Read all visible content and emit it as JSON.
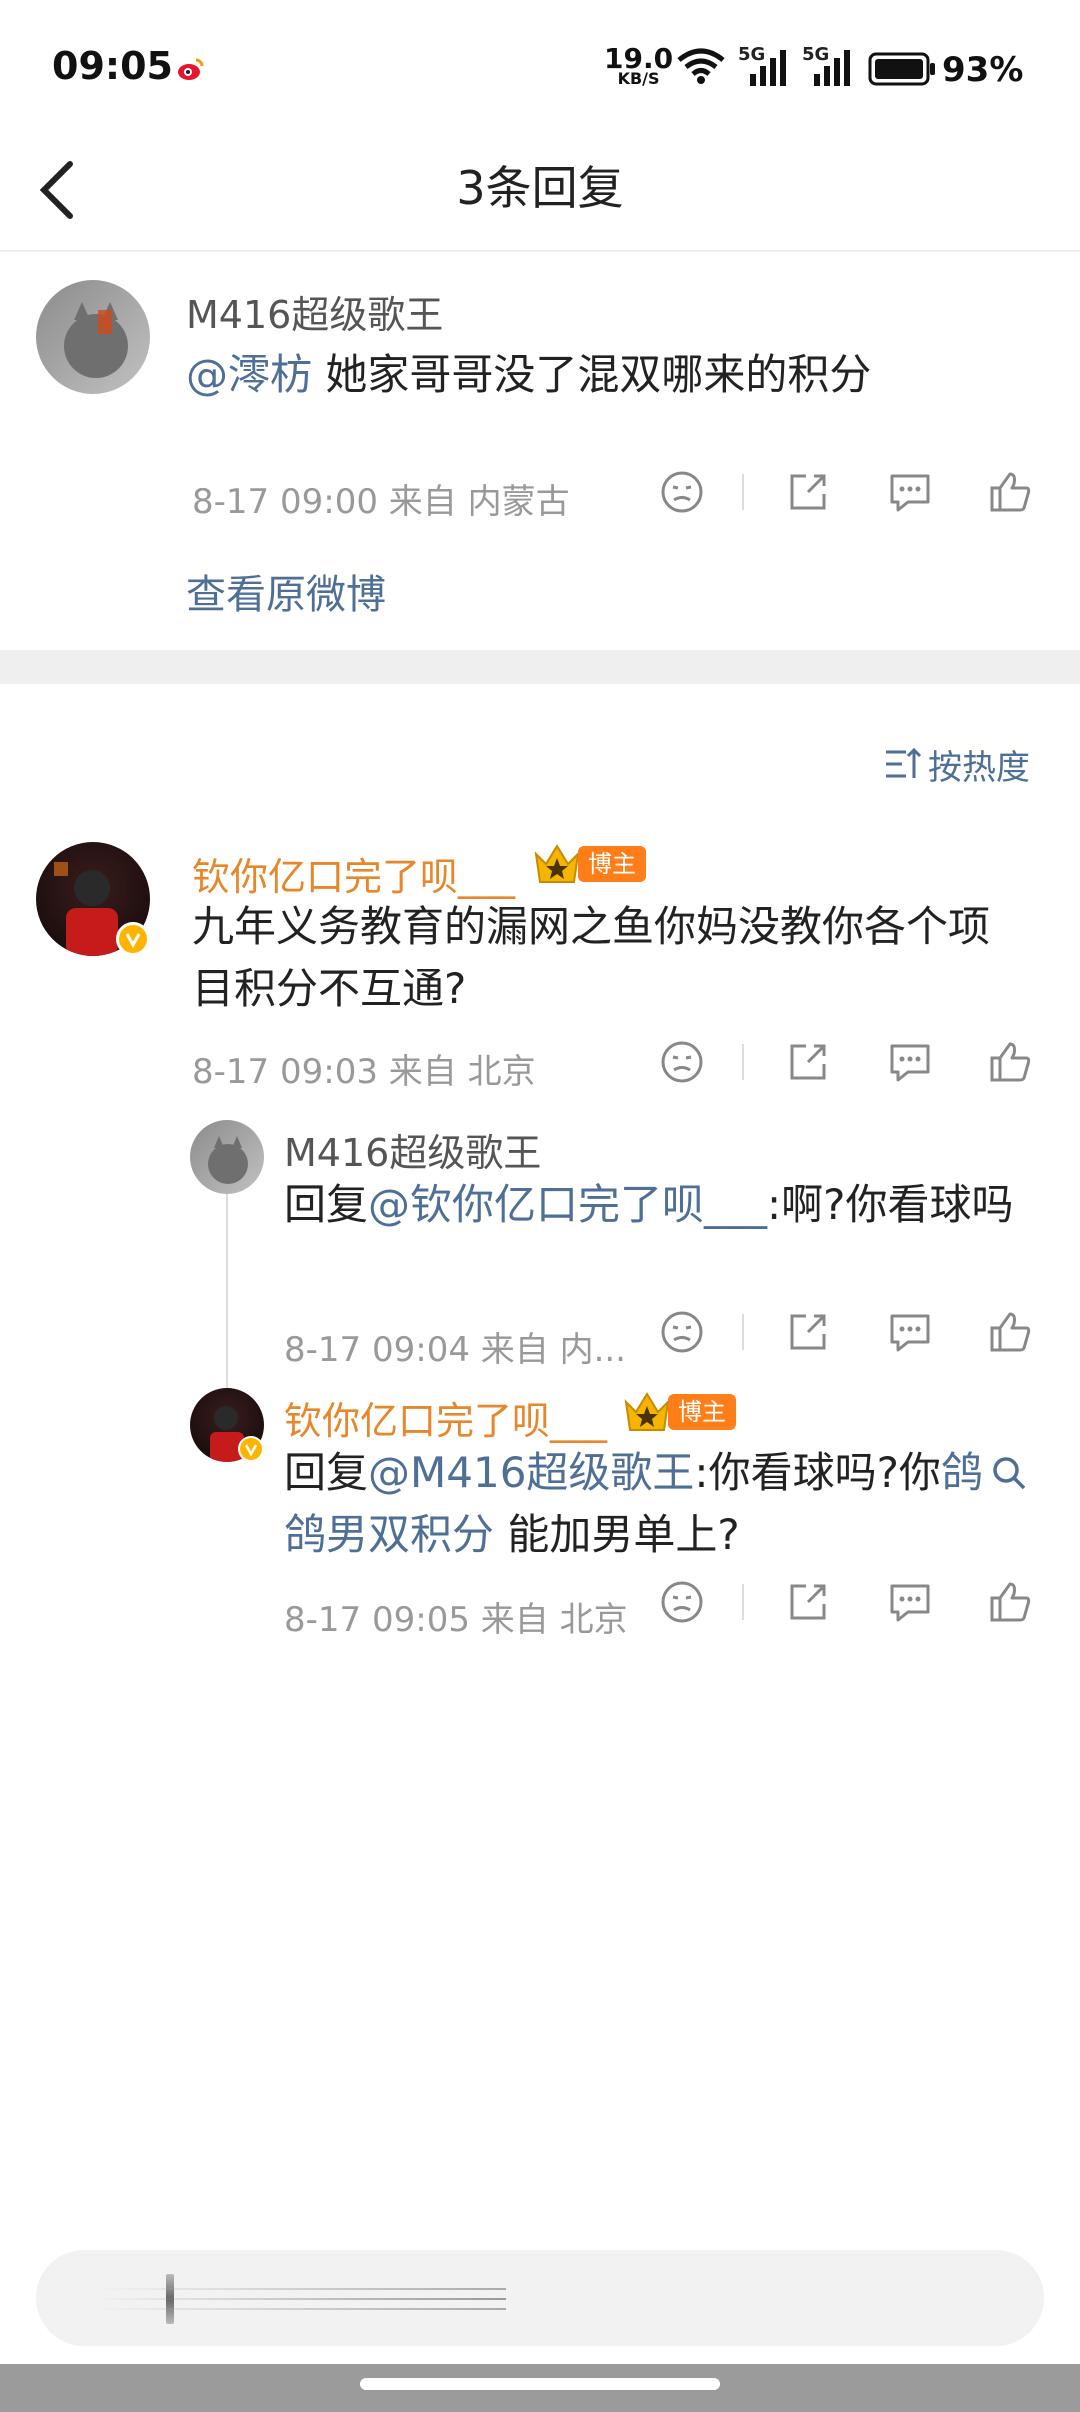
{
  "status": {
    "time": "09:05",
    "net_speed": "19.0",
    "net_unit": "KB/S",
    "signal_1": "5G",
    "signal_2": "5G",
    "battery": "93%"
  },
  "header": {
    "title": "3条回复"
  },
  "root_comment": {
    "user": "M416超级歌王",
    "mention": "@澪枋",
    "text": " 她家哥哥没了混双哪来的积分",
    "meta": "8-17 09:00  来自 内蒙古",
    "view_original": "查看原微博"
  },
  "sort": {
    "label": "按热度"
  },
  "replies": [
    {
      "user": "钦你亿口完了呗___",
      "badge": "博主",
      "text": "九年义务教育的漏网之鱼你妈没教你各个项目积分不互通?",
      "meta": "8-17 09:03  来自 北京"
    },
    {
      "user": "M416超级歌王",
      "prefix": "回复",
      "mention": "@钦你亿口完了呗___",
      "text": ":啊?你看球吗",
      "meta": "8-17 09:04  来自 内..."
    },
    {
      "user": "钦你亿口完了呗___",
      "badge": "博主",
      "prefix": "回复",
      "mention": "@M416超级歌王",
      "text": ":你看球吗?你",
      "link": "鸽鸽男双积分",
      "text2": " 能加男单上?",
      "meta": "8-17 09:05  来自 北京"
    }
  ],
  "colors": {
    "accent": "#4f6f96",
    "orange": "#e8862a",
    "badge": "#ff7e1a"
  }
}
